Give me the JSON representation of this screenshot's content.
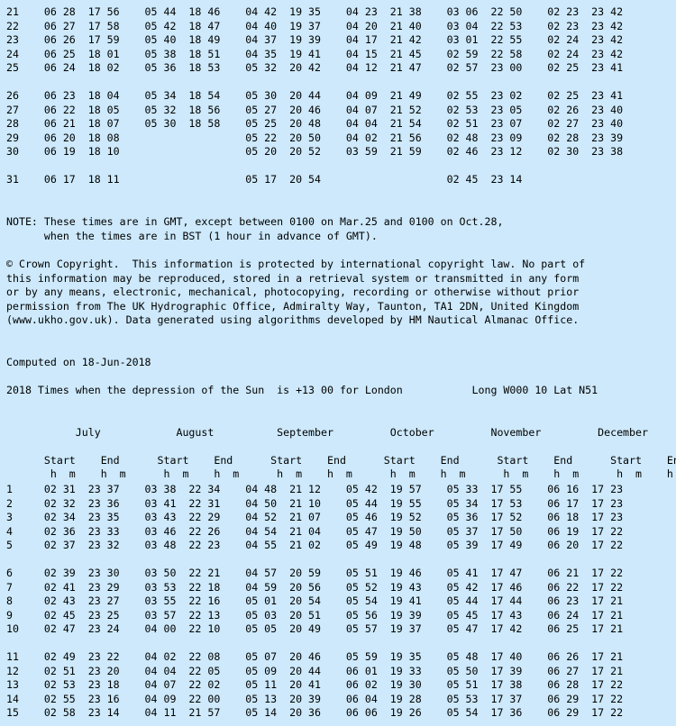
{
  "first_table": {
    "rows": [
      "21    06 28  17 56    05 44  18 46    04 42  19 35    04 23  21 38    03 06  22 50    02 23  23 42",
      "22    06 27  17 58    05 42  18 47    04 40  19 37    04 20  21 40    03 04  22 53    02 23  23 42",
      "23    06 26  17 59    05 40  18 49    04 37  19 39    04 17  21 42    03 01  22 55    02 24  23 42",
      "24    06 25  18 01    05 38  18 51    04 35  19 41    04 15  21 45    02 59  22 58    02 24  23 42",
      "25    06 24  18 02    05 36  18 53    05 32  20 42    04 12  21 47    02 57  23 00    02 25  23 41",
      "26    06 23  18 04    05 34  18 54    05 30  20 44    04 09  21 49    02 55  23 02    02 25  23 41",
      "27    06 22  18 05    05 32  18 56    05 27  20 46    04 07  21 52    02 53  23 05    02 26  23 40",
      "28    06 21  18 07    05 30  18 58    05 25  20 48    04 04  21 54    02 51  23 07    02 27  23 40",
      "29    06 20  18 08                    05 22  20 50    04 02  21 56    02 48  23 09    02 28  23 39",
      "30    06 19  18 10                    05 20  20 52    03 59  21 59    02 46  23 12    02 30  23 38",
      "31    06 17  18 11                    05 17  20 54                    02 45  23 14"
    ]
  },
  "note": {
    "line1": "NOTE: These times are in GMT, except between 0100 on Mar.25 and 0100 on Oct.28,",
    "line2": "      when the times are in BST (1 hour in advance of GMT)."
  },
  "copyright": {
    "lines": [
      "© Crown Copyright.  This information is protected by international copyright law. No part of",
      "this information may be reproduced, stored in a retrieval system or transmitted in any form",
      "or by any means, electronic, mechanical, photocopying, recording or otherwise without prior",
      "permission from The UK Hydrographic Office, Admiralty Way, Taunton, TA1 2DN, United Kingdom",
      "(www.ukho.gov.uk). Data generated using algorithms developed by HM Nautical Almanac Office."
    ]
  },
  "computed": "Computed on 18-Jun-2018",
  "report_title": "2018 Times when the depression of the Sun  is +13 00 for London           Long W000 10 Lat N51",
  "second_table": {
    "month_header": "           July            August          September         October         November         December",
    "start_end_header": "      Start    End      Start    End      Start    End      Start    End      Start    End      Start    End",
    "hm_header": "       h  m    h  m      h  m    h  m      h  m    h  m      h  m    h  m      h  m    h  m      h  m    h  m",
    "rows": [
      "1     02 31  23 37    03 38  22 34    04 48  21 12    05 42  19 57    05 33  17 55    06 16  17 23",
      "2     02 32  23 36    03 41  22 31    04 50  21 10    05 44  19 55    05 34  17 53    06 17  17 23",
      "3     02 34  23 35    03 43  22 29    04 52  21 07    05 46  19 52    05 36  17 52    06 18  17 23",
      "4     02 36  23 33    03 46  22 26    04 54  21 04    05 47  19 50    05 37  17 50    06 19  17 22",
      "5     02 37  23 32    03 48  22 23    04 55  21 02    05 49  19 48    05 39  17 49    06 20  17 22",
      "6     02 39  23 30    03 50  22 21    04 57  20 59    05 51  19 46    05 41  17 47    06 21  17 22",
      "7     02 41  23 29    03 53  22 18    04 59  20 56    05 52  19 43    05 42  17 46    06 22  17 22",
      "8     02 43  23 27    03 55  22 16    05 01  20 54    05 54  19 41    05 44  17 44    06 23  17 21",
      "9     02 45  23 25    03 57  22 13    05 03  20 51    05 56  19 39    05 45  17 43    06 24  17 21",
      "10    02 47  23 24    04 00  22 10    05 05  20 49    05 57  19 37    05 47  17 42    06 25  17 21",
      "11    02 49  23 22    04 02  22 08    05 07  20 46    05 59  19 35    05 48  17 40    06 26  17 21",
      "12    02 51  23 20    04 04  22 05    05 09  20 44    06 01  19 33    05 50  17 39    06 27  17 21",
      "13    02 53  23 18    04 07  22 02    05 11  20 41    06 02  19 30    05 51  17 38    06 28  17 22",
      "14    02 55  23 16    04 09  22 00    05 13  20 39    06 04  19 28    05 53  17 37    06 29  17 22",
      "15    02 58  23 14    04 11  21 57    05 14  20 36    06 06  19 26    05 54  17 36    06 29  17 22"
    ]
  }
}
